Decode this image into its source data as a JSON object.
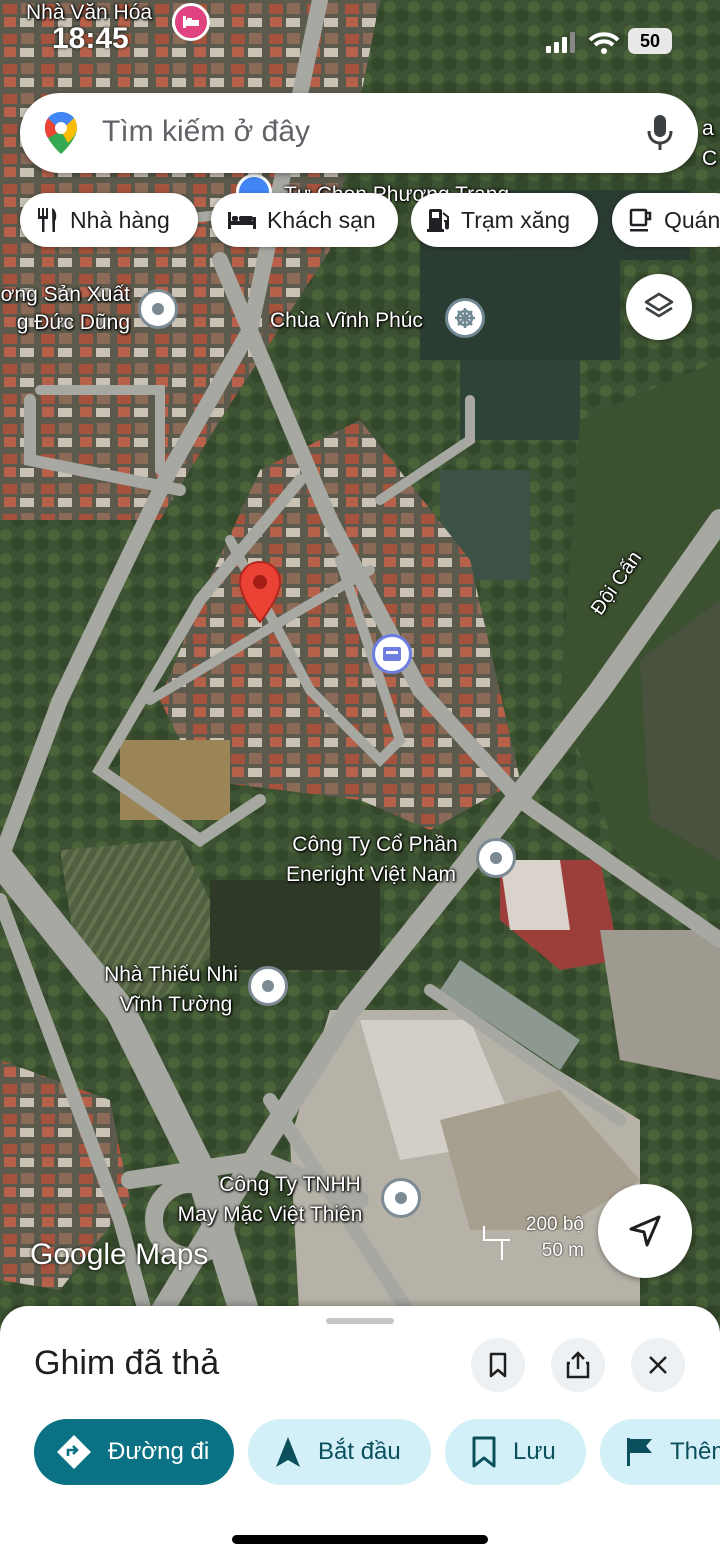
{
  "status_bar": {
    "time": "18:45",
    "battery": "50"
  },
  "search": {
    "placeholder": "Tìm kiếm ở đây"
  },
  "chips": [
    {
      "label": "Nhà hàng",
      "icon": "fork-knife-icon"
    },
    {
      "label": "Khách sạn",
      "icon": "bed-icon"
    },
    {
      "label": "Trạm xăng",
      "icon": "gas-station-icon"
    },
    {
      "label": "Quán",
      "icon": "coffee-cup-icon"
    }
  ],
  "map": {
    "labels": {
      "nha_van_hoa": "Nhà Văn Hóa",
      "tu_chon": "Tự Chọn Phượng Trang",
      "san_xuat_1": "ơng Sản Xuất",
      "san_xuat_2": "g Đức Dũng",
      "chua": "Chùa Vĩnh Phúc",
      "doi_can": "Đội Cấn",
      "cong_ty_1a": "Công Ty Cổ Phần",
      "cong_ty_1b": "Eneright Việt Nam",
      "nha_thieu_nhi_a": "Nhà Thiếu Nhi",
      "nha_thieu_nhi_b": "Vĩnh Tường",
      "cong_ty_2a": "Công Ty TNHH",
      "cong_ty_2b": "May Mặc Việt Thiên",
      "edge_right_1": "a",
      "edge_right_2": "C"
    },
    "scale": {
      "feet": "200 bộ",
      "meters": "50 m"
    },
    "attribution": "Google Maps",
    "colors": {
      "pin": "#ea4335",
      "hotel_pin": "#e0437f",
      "atm_pin": "#6d7ee0"
    }
  },
  "sheet": {
    "title": "Ghim đã thả",
    "actions": [
      {
        "label": "Đường đi",
        "icon": "directions-icon"
      },
      {
        "label": "Bắt đầu",
        "icon": "navigation-arrow-icon"
      },
      {
        "label": "Lưu",
        "icon": "bookmark-icon"
      },
      {
        "label": "Thêm",
        "icon": "flag-icon"
      }
    ]
  }
}
